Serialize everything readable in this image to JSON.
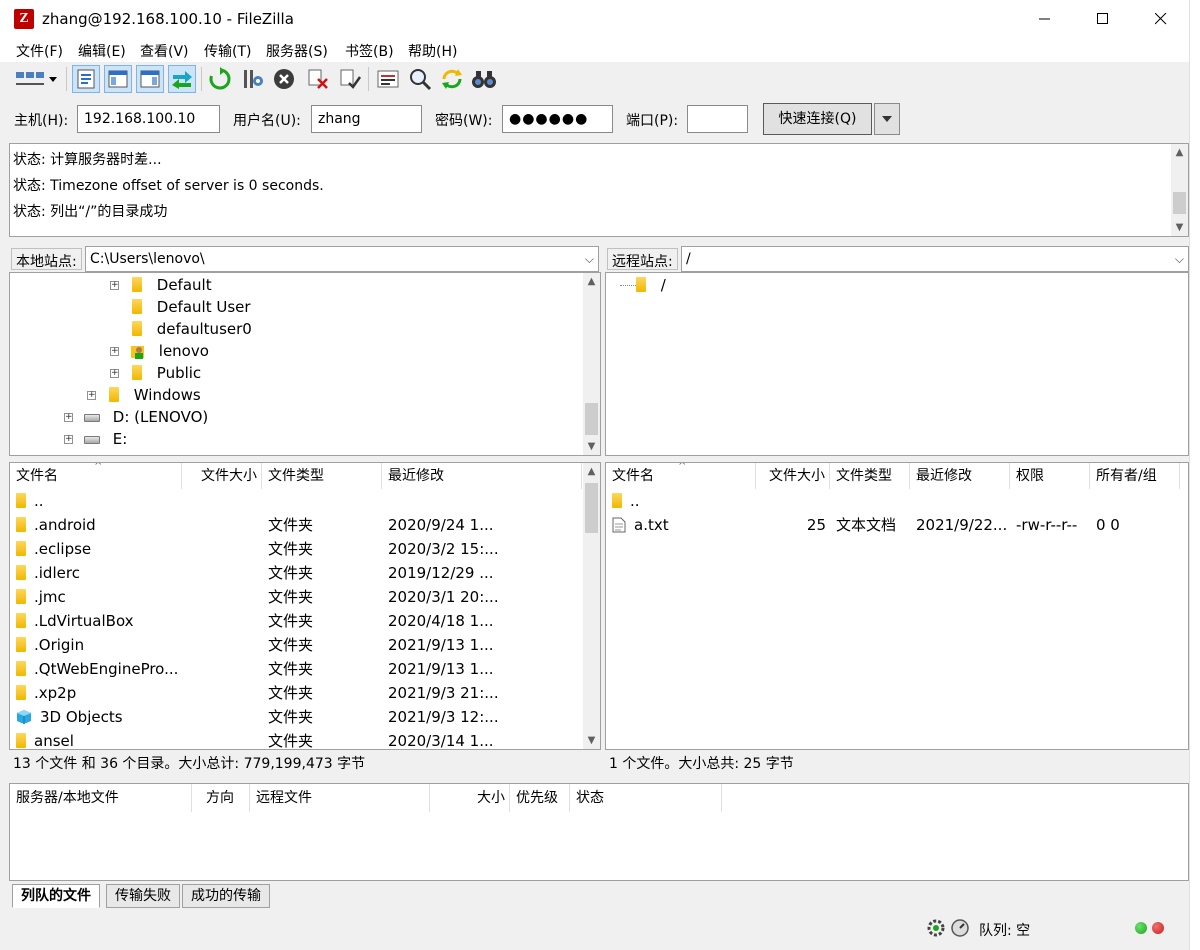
{
  "window": {
    "title": "zhang@192.168.100.10 - FileZilla",
    "app_icon": "Z"
  },
  "menu": [
    "文件(F)",
    "编辑(E)",
    "查看(V)",
    "传输(T)",
    "服务器(S)",
    "书签(B)",
    "帮助(H)"
  ],
  "quickconnect": {
    "host_label": "主机(H):",
    "host_value": "192.168.100.10",
    "user_label": "用户名(U):",
    "user_value": "zhang",
    "pass_label": "密码(W):",
    "pass_value": "●●●●●●",
    "port_label": "端口(P):",
    "port_value": "",
    "connect_label": "快速连接(Q)"
  },
  "log": [
    "状态:  计算服务器时差...",
    "状态:  Timezone offset of server is 0 seconds.",
    "状态:  列出“/”的目录成功"
  ],
  "local": {
    "site_label": "本地站点:",
    "path": "C:\\Users\\lenovo\\",
    "tree": [
      {
        "label": "Default"
      },
      {
        "label": "Default User"
      },
      {
        "label": "defaultuser0"
      },
      {
        "label": "lenovo"
      },
      {
        "label": "Public"
      },
      {
        "label": "Windows"
      },
      {
        "label": "D: (LENOVO)"
      },
      {
        "label": "E:"
      }
    ],
    "headers": [
      "文件名",
      "文件大小",
      "文件类型",
      "最近修改"
    ],
    "files": [
      {
        "name": "..",
        "size": "",
        "type": "",
        "modified": ""
      },
      {
        "name": ".android",
        "size": "",
        "type": "文件夹",
        "modified": "2020/9/24 1..."
      },
      {
        "name": ".eclipse",
        "size": "",
        "type": "文件夹",
        "modified": "2020/3/2 15:..."
      },
      {
        "name": ".idlerc",
        "size": "",
        "type": "文件夹",
        "modified": "2019/12/29 ..."
      },
      {
        "name": ".jmc",
        "size": "",
        "type": "文件夹",
        "modified": "2020/3/1 20:..."
      },
      {
        "name": ".LdVirtualBox",
        "size": "",
        "type": "文件夹",
        "modified": "2020/4/18 1..."
      },
      {
        "name": ".Origin",
        "size": "",
        "type": "文件夹",
        "modified": "2021/9/13 1..."
      },
      {
        "name": ".QtWebEnginePro...",
        "size": "",
        "type": "文件夹",
        "modified": "2021/9/13 1..."
      },
      {
        "name": ".xp2p",
        "size": "",
        "type": "文件夹",
        "modified": "2021/9/3 21:..."
      },
      {
        "name": "3D Objects",
        "size": "",
        "type": "文件夹",
        "modified": "2021/9/3 12:..."
      },
      {
        "name": "ansel",
        "size": "",
        "type": "文件夹",
        "modified": "2020/3/14 1..."
      }
    ],
    "status": "13 个文件 和 36 个目录。大小总计: 779,199,473 字节"
  },
  "remote": {
    "site_label": "远程站点:",
    "path": "/",
    "tree": [
      {
        "label": "/"
      }
    ],
    "headers": [
      "文件名",
      "文件大小",
      "文件类型",
      "最近修改",
      "权限",
      "所有者/组"
    ],
    "files": [
      {
        "name": "..",
        "size": "",
        "type": "",
        "modified": "",
        "perm": "",
        "owner": ""
      },
      {
        "name": "a.txt",
        "size": "25",
        "type": "文本文档",
        "modified": "2021/9/22...",
        "perm": "-rw-r--r--",
        "owner": "0 0"
      }
    ],
    "status": "1 个文件。大小总共: 25 字节"
  },
  "queue": {
    "headers": [
      "服务器/本地文件",
      "方向",
      "远程文件",
      "大小",
      "优先级",
      "状态"
    ]
  },
  "tabs": [
    "列队的文件",
    "传输失败",
    "成功的传输"
  ],
  "statusbar": {
    "queue": "队列: 空"
  },
  "colors": {
    "folder": "#f5c518",
    "led_green": "#1aa51a",
    "led_red": "#c81e1e"
  }
}
